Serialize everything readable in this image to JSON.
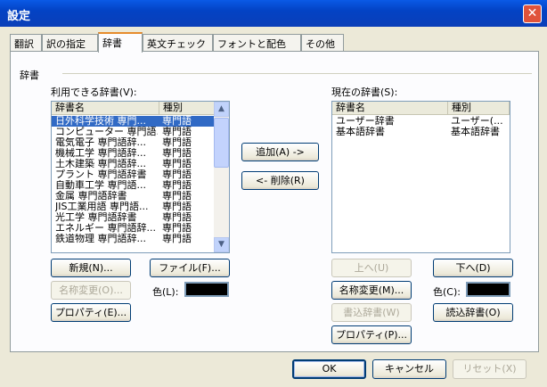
{
  "window": {
    "title": "設定",
    "close_glyph": "✕"
  },
  "tabs": [
    {
      "label": "翻訳"
    },
    {
      "label": "訳の指定"
    },
    {
      "label": "辞書"
    },
    {
      "label": "英文チェック"
    },
    {
      "label": "フォントと配色"
    },
    {
      "label": "その他"
    }
  ],
  "group": {
    "label": "辞書"
  },
  "available": {
    "label": "利用できる辞書(V):",
    "col_name": "辞書名",
    "col_type": "種別",
    "rows": [
      {
        "name": "日外科学技術 専門...",
        "type": "専門語"
      },
      {
        "name": "コンピューター 専門語...",
        "type": "専門語"
      },
      {
        "name": "電気電子 専門語辞...",
        "type": "専門語"
      },
      {
        "name": "機械工学 専門語辞...",
        "type": "専門語"
      },
      {
        "name": "土木建築 専門語辞...",
        "type": "専門語"
      },
      {
        "name": "プラント 専門語辞書",
        "type": "専門語"
      },
      {
        "name": "自動車工学 専門語...",
        "type": "専門語"
      },
      {
        "name": "金属 専門語辞書",
        "type": "専門語"
      },
      {
        "name": "JIS工業用語 専門語...",
        "type": "専門語"
      },
      {
        "name": "光工学 専門語辞書",
        "type": "専門語"
      },
      {
        "name": "エネルギー 専門語辞...",
        "type": "専門語"
      },
      {
        "name": "鉄道物理 専門語辞...",
        "type": "専門語"
      }
    ],
    "scroll_up": "▲",
    "scroll_down": "▼",
    "new_btn": "新規(N)...",
    "file_btn": "ファイル(F)...",
    "rename_btn": "名称変更(O)...",
    "color_label": "色(L):",
    "props_btn": "プロパティ(E)...",
    "color": "#000000"
  },
  "actions": {
    "add_btn": "追加(A) ->",
    "remove_btn": "<- 削除(R)"
  },
  "current": {
    "label": "現在の辞書(S):",
    "col_name": "辞書名",
    "col_type": "種別",
    "rows": [
      {
        "name": "ユーザー辞書",
        "type": "ユーザー(..."
      },
      {
        "name": "基本語辞書",
        "type": "基本語辞書"
      }
    ],
    "up_btn": "上へ(U)",
    "down_btn": "下へ(D)",
    "rename_btn": "名称変更(M)...",
    "color_label": "色(C):",
    "write_btn": "書込辞書(W)",
    "read_btn": "読込辞書(O)",
    "props_btn": "プロパティ(P)...",
    "color": "#000000"
  },
  "footer": {
    "ok_btn": "OK",
    "cancel_btn": "キャンセル",
    "reset_btn": "リセット(X)"
  }
}
